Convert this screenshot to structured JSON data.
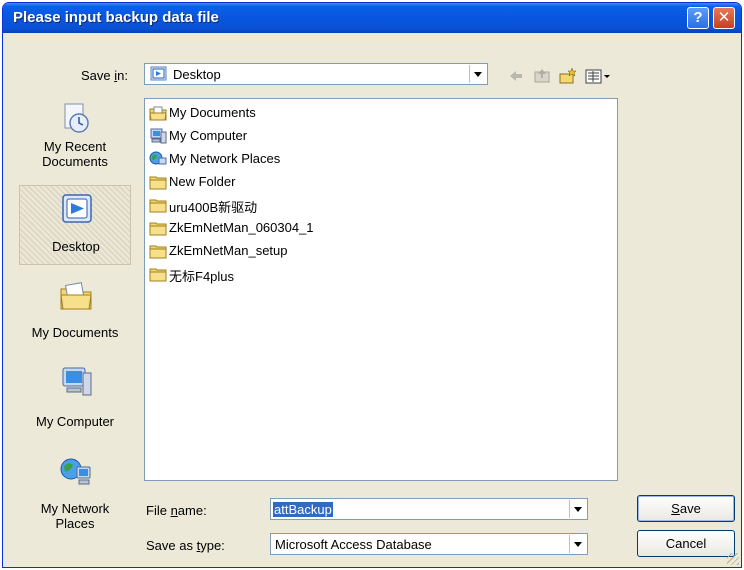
{
  "dialog": {
    "title": "Please input backup data file",
    "help_glyph": "?",
    "close_glyph": "✕"
  },
  "save_in": {
    "label_pre": "Save ",
    "label_accel": "i",
    "label_post": "n:",
    "value": "Desktop"
  },
  "toolbar": {
    "icons": [
      "back-arrow-icon",
      "up-folder-icon",
      "new-folder-icon",
      "views-menu-icon"
    ]
  },
  "places": [
    {
      "label": "My Recent Documents",
      "line1": "My Recent",
      "line2": "Documents",
      "icon": "recent-documents-icon"
    },
    {
      "label": "Desktop",
      "line1": "Desktop",
      "line2": "",
      "icon": "desktop-icon",
      "selected": true
    },
    {
      "label": "My Documents",
      "line1": "My Documents",
      "line2": "",
      "icon": "my-documents-icon"
    },
    {
      "label": "My Computer",
      "line1": "My Computer",
      "line2": "",
      "icon": "my-computer-icon"
    },
    {
      "label": "My Network Places",
      "line1": "My Network",
      "line2": "Places",
      "icon": "network-places-icon"
    }
  ],
  "files": [
    {
      "name": "My Documents",
      "icon": "my-documents-folder-icon"
    },
    {
      "name": "My Computer",
      "icon": "my-computer-icon"
    },
    {
      "name": "My Network Places",
      "icon": "network-places-icon"
    },
    {
      "name": "New Folder",
      "icon": "folder-icon"
    },
    {
      "name": "uru400B新驱动",
      "icon": "folder-icon"
    },
    {
      "name": "ZkEmNetMan_060304_1",
      "icon": "folder-icon"
    },
    {
      "name": "ZkEmNetMan_setup",
      "icon": "folder-icon"
    },
    {
      "name": "无标F4plus",
      "icon": "folder-icon"
    }
  ],
  "file_name": {
    "label_pre": "File ",
    "label_accel": "n",
    "label_post": "ame:",
    "value": "attBackup"
  },
  "save_type": {
    "label_pre": "Save as ",
    "label_accel": "t",
    "label_post": "ype:",
    "value": "Microsoft Access Database"
  },
  "buttons": {
    "save_accel": "S",
    "save_rest": "ave",
    "cancel": "Cancel"
  },
  "colors": {
    "titlebar": "#0856e0",
    "dialog_bg": "#ece9d8",
    "selection": "#316ac5",
    "folder": "#f5d76e"
  }
}
